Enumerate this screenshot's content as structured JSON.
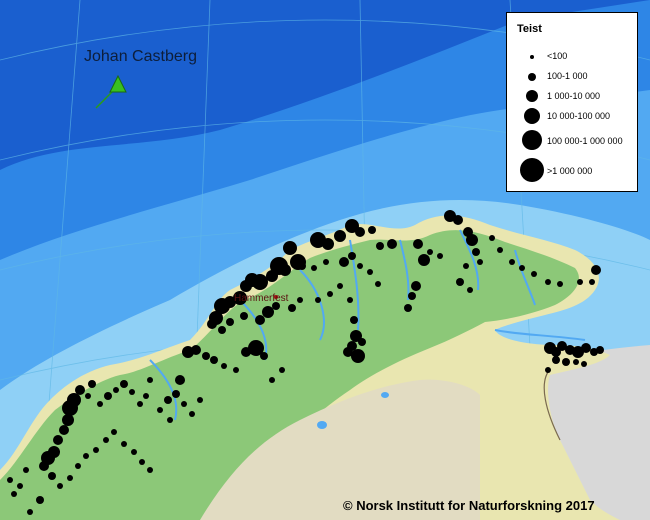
{
  "legend": {
    "title": "Teist",
    "classes": [
      {
        "label": "<100"
      },
      {
        "label": "100-1 000"
      },
      {
        "label": "1 000-10 000"
      },
      {
        "label": "10 000-100 000"
      },
      {
        "label": "100 000-1 000 000"
      },
      {
        "label": ">1 000 000"
      }
    ]
  },
  "field_label": "Johan Castberg",
  "place_label": "Hammerfest",
  "copyright": "© Norsk Institutt for Naturforskning 2017",
  "colors": {
    "deep_sea": "#1a5fcf",
    "mid_sea": "#2e86e6",
    "shelf_sea": "#52a9f2",
    "coastal_sea": "#8fd0f6",
    "land_lowland": "#e9e6b0",
    "land_green": "#8cc878",
    "foreign_land": "#d8d8d8",
    "colony_dot": "#000000",
    "field_marker": "#39c01f"
  }
}
